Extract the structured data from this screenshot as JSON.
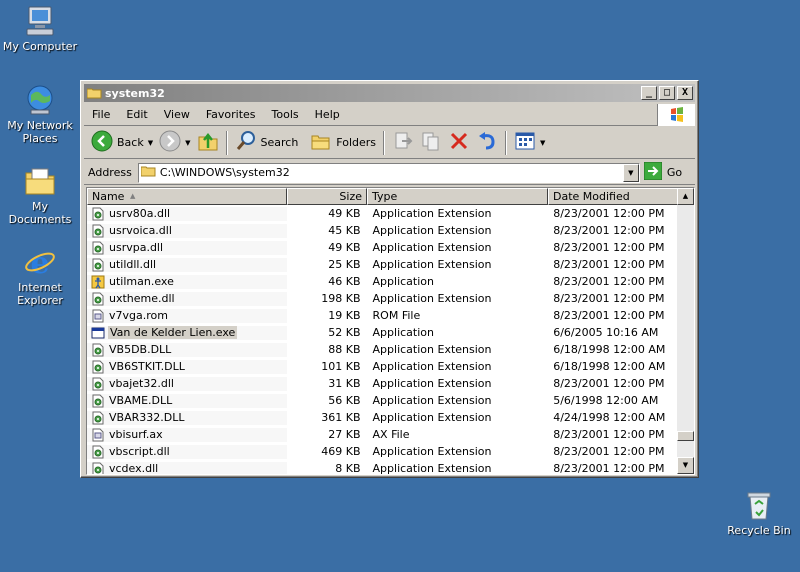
{
  "desktop": {
    "icons": [
      {
        "label": "My Computer",
        "icon": "my-computer-icon"
      },
      {
        "label": "My Network Places",
        "icon": "network-places-icon"
      },
      {
        "label": "My Documents",
        "icon": "my-documents-icon"
      },
      {
        "label": "Internet Explorer",
        "icon": "internet-explorer-icon"
      },
      {
        "label": "Recycle Bin",
        "icon": "recycle-bin-icon"
      }
    ]
  },
  "window": {
    "title": "system32",
    "controls": {
      "minimize": "_",
      "maximize": "□",
      "close": "X"
    }
  },
  "menubar": {
    "items": [
      "File",
      "Edit",
      "View",
      "Favorites",
      "Tools",
      "Help"
    ]
  },
  "toolbar": {
    "back_label": "Back",
    "search_label": "Search",
    "folders_label": "Folders"
  },
  "address": {
    "label": "Address",
    "value": "C:\\WINDOWS\\system32",
    "go_label": "Go"
  },
  "list": {
    "columns": [
      "Name",
      "Size",
      "Type",
      "Date Modified"
    ],
    "rows": [
      {
        "name": "usrv80a.dll",
        "size": "49 KB",
        "type": "Application Extension",
        "date": "8/23/2001 12:00 PM",
        "icon": "dll-icon"
      },
      {
        "name": "usrvoica.dll",
        "size": "45 KB",
        "type": "Application Extension",
        "date": "8/23/2001 12:00 PM",
        "icon": "dll-icon"
      },
      {
        "name": "usrvpa.dll",
        "size": "49 KB",
        "type": "Application Extension",
        "date": "8/23/2001 12:00 PM",
        "icon": "dll-icon"
      },
      {
        "name": "utildll.dll",
        "size": "25 KB",
        "type": "Application Extension",
        "date": "8/23/2001 12:00 PM",
        "icon": "dll-icon"
      },
      {
        "name": "utilman.exe",
        "size": "46 KB",
        "type": "Application",
        "date": "8/23/2001 12:00 PM",
        "icon": "utilman-icon"
      },
      {
        "name": "uxtheme.dll",
        "size": "198 KB",
        "type": "Application Extension",
        "date": "8/23/2001 12:00 PM",
        "icon": "dll-icon"
      },
      {
        "name": "v7vga.rom",
        "size": "19 KB",
        "type": "ROM File",
        "date": "8/23/2001 12:00 PM",
        "icon": "generic-file-icon"
      },
      {
        "name": "Van de Kelder Lien.exe",
        "size": "52 KB",
        "type": "Application",
        "date": "6/6/2005 10:16 AM",
        "icon": "application-window-icon"
      },
      {
        "name": "VB5DB.DLL",
        "size": "88 KB",
        "type": "Application Extension",
        "date": "6/18/1998 12:00 AM",
        "icon": "dll-icon"
      },
      {
        "name": "VB6STKIT.DLL",
        "size": "101 KB",
        "type": "Application Extension",
        "date": "6/18/1998 12:00 AM",
        "icon": "dll-icon"
      },
      {
        "name": "vbajet32.dll",
        "size": "31 KB",
        "type": "Application Extension",
        "date": "8/23/2001 12:00 PM",
        "icon": "dll-icon"
      },
      {
        "name": "VBAME.DLL",
        "size": "56 KB",
        "type": "Application Extension",
        "date": "5/6/1998 12:00 AM",
        "icon": "dll-icon"
      },
      {
        "name": "VBAR332.DLL",
        "size": "361 KB",
        "type": "Application Extension",
        "date": "4/24/1998 12:00 AM",
        "icon": "dll-icon"
      },
      {
        "name": "vbisurf.ax",
        "size": "27 KB",
        "type": "AX File",
        "date": "8/23/2001 12:00 PM",
        "icon": "generic-file-icon"
      },
      {
        "name": "vbscript.dll",
        "size": "469 KB",
        "type": "Application Extension",
        "date": "8/23/2001 12:00 PM",
        "icon": "dll-icon"
      },
      {
        "name": "vcdex.dll",
        "size": "8 KB",
        "type": "Application Extension",
        "date": "8/23/2001 12:00 PM",
        "icon": "dll-icon"
      }
    ],
    "selected_index": 7
  },
  "colors": {
    "desktop": "#3a6ea5",
    "window_face": "#d4d0c8",
    "titlebar_inactive_start": "#808080",
    "titlebar_inactive_end": "#c0c0c0"
  }
}
